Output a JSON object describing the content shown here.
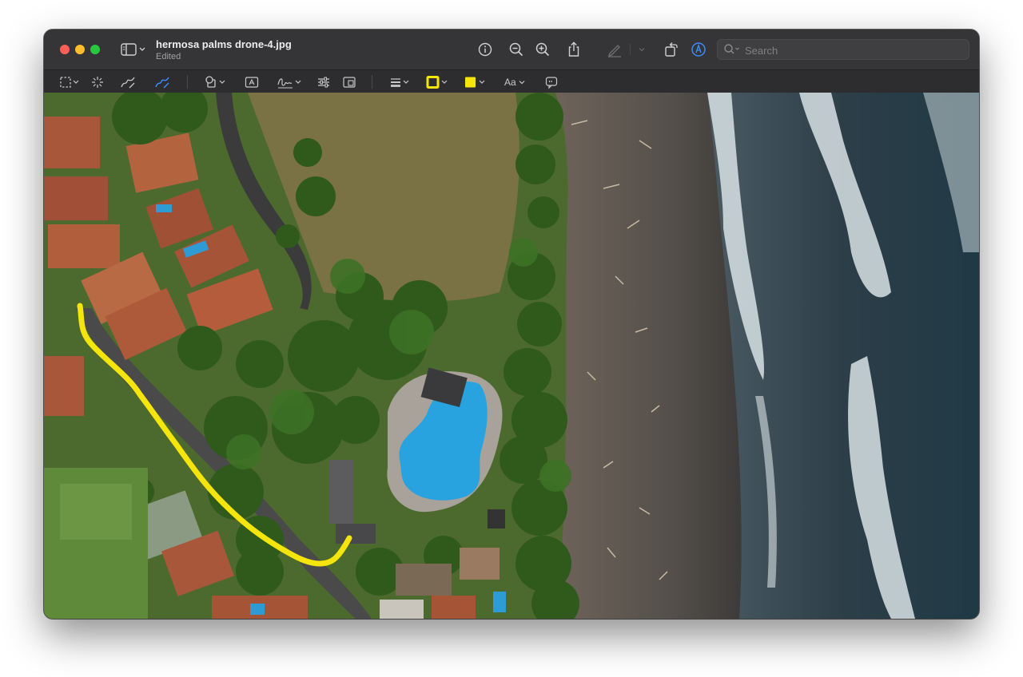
{
  "window": {
    "title": "hermosa palms drone-4.jpg",
    "subtitle": "Edited"
  },
  "search": {
    "placeholder": "Search"
  },
  "toolbar": {
    "font_label": "Aa",
    "border_color": "#f5e50a",
    "fill_color": "#f5e50a"
  },
  "annotation": {
    "stroke_color": "#f5e50a"
  },
  "icons": {
    "sidebar": "sidebar-icon",
    "info": "info-icon",
    "zoom_out": "zoom-out-icon",
    "zoom_in": "zoom-in-icon",
    "share": "share-icon",
    "highlight": "highlighter-icon",
    "rotate": "rotate-icon",
    "markup": "markup-icon",
    "selection": "selection-icon",
    "instant_alpha": "instant-alpha-icon",
    "sketch": "sketch-icon",
    "draw": "draw-icon",
    "shapes": "shapes-icon",
    "text": "text-box-icon",
    "sign": "signature-icon",
    "adjust": "adjust-color-icon",
    "size": "adjust-size-icon",
    "line_style": "line-style-icon",
    "note": "note-icon"
  }
}
